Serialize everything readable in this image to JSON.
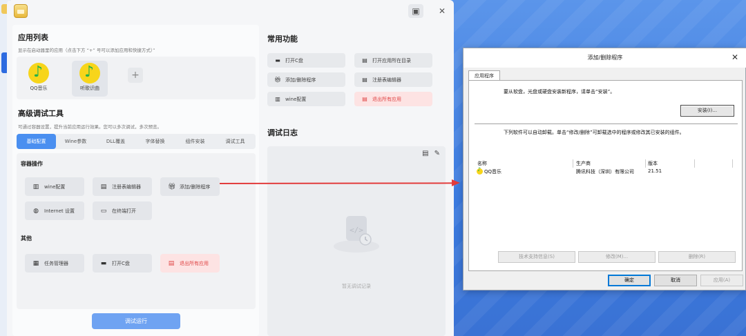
{
  "app": {
    "left": {
      "app_list_title": "应用列表",
      "app_list_hint": "显示在启动器里的应用（点击下方 “+” 号可以添加应用和快捷方式）”",
      "apps": [
        {
          "label": "QQ音乐",
          "icon": "qq-music-icon"
        },
        {
          "label": "听歌识曲",
          "icon": "qq-music-icon"
        }
      ],
      "add_label": "+",
      "debug_title": "高级调试工具",
      "debug_hint": "可通过容器设置，提升当前应用运行效果。您可以多次调试，多次预览。",
      "tabs": [
        "基础配置",
        "Wine参数",
        "DLL覆盖",
        "字体替换",
        "组件安装",
        "调试工具"
      ],
      "active_tab": 0,
      "container_title": "容器操作",
      "container_ops": [
        {
          "label": "wine配置",
          "icon": "wine-config-icon"
        },
        {
          "label": "注册表编辑器",
          "icon": "registry-icon"
        },
        {
          "label": "添加/删除程序",
          "icon": "gift-box-icon"
        },
        {
          "label": "Internet 设置",
          "icon": "globe-icon"
        },
        {
          "label": "在终端打开",
          "icon": "terminal-icon"
        }
      ],
      "other_title": "其他",
      "other_ops": [
        {
          "label": "任务管理器",
          "icon": "briefcase-icon"
        },
        {
          "label": "打开C盘",
          "icon": "drive-icon"
        },
        {
          "label": "退出所有应用",
          "icon": "exit-icon"
        }
      ],
      "run_label": "调试运行"
    },
    "right": {
      "common_title": "常用功能",
      "functions": [
        {
          "label": "打开C盘",
          "icon": "drive-icon"
        },
        {
          "label": "打开应用所在目录",
          "icon": "folder-icon"
        },
        {
          "label": "添加/删除程序",
          "icon": "gift-box-icon"
        },
        {
          "label": "注册表编辑器",
          "icon": "registry-icon"
        },
        {
          "label": "wine配置",
          "icon": "wine-config-icon"
        },
        {
          "label": "退出所有应用",
          "icon": "exit-icon"
        }
      ],
      "log_title": "调试日志",
      "log_empty": "暂无调试记录"
    }
  },
  "dialog": {
    "title": "添加/删除程序",
    "tab": "应用程序",
    "install_hint": "要从软盘，光盘或硬盘安装新程序，请单击“安装”。",
    "install_button": "安装(I)...",
    "uninstall_hint": "下列软件可以自动卸载。单击“修改/删除”可卸载选中的程序或修改其已安装的组件。",
    "columns": [
      "名称",
      "生产商",
      "版本"
    ],
    "rows": [
      {
        "name": "QQ音乐",
        "publisher": "腾讯科技（深圳）有限公司",
        "version": "21.51"
      }
    ],
    "support_button": "技术支持信息(S)",
    "modify_button": "修改(M)...",
    "remove_button": "删除(R)",
    "ok_button": "确定",
    "cancel_button": "取消",
    "apply_button": "应用(A)"
  },
  "colors": {
    "accent": "#4a8ff0",
    "danger": "#e04646",
    "arrow": "#e23c3c"
  }
}
